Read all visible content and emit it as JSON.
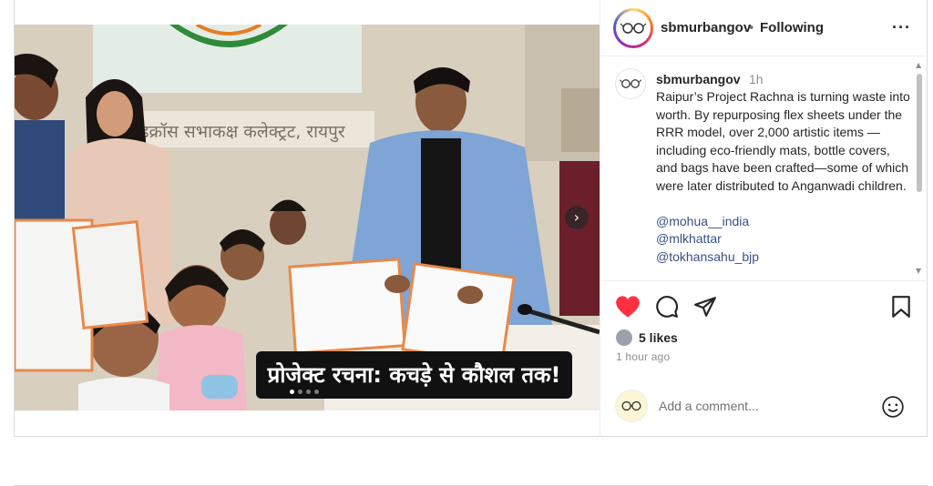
{
  "post": {
    "media": {
      "alt_banner_text": "प्रोजेक्ट रचना: कचड़े से कौशल तक!",
      "sign_text": "डक्रॉस सभाकक्ष कलेक्ट्रट, रायपुर",
      "carousel_dots": 4,
      "active_dot": 1,
      "next_icon": "chevron-right-icon"
    },
    "header": {
      "username": "sbmurbangov",
      "separator": "•",
      "follow_status": "Following",
      "more_icon": "more-horizontal-icon"
    },
    "caption": {
      "username": "sbmurbangov",
      "time": "1h",
      "text": "Raipur’s Project Rachna is turning waste into worth. By repurposing flex sheets under the RRR model, over 2,000 artistic items — including eco-friendly mats, bottle covers, and bags have been crafted—some of which were later distributed to Anganwadi children.",
      "mentions": [
        "@mohua__india",
        "@mlkhattar",
        "@tokhansahu_bjp"
      ]
    },
    "actions": {
      "like_icon": "heart-filled-icon",
      "comment_icon": "comment-icon",
      "share_icon": "send-icon",
      "save_icon": "bookmark-icon",
      "like_color": "#ff3040"
    },
    "likes": "5 likes",
    "posted_ago": "1 hour ago",
    "add_comment": {
      "placeholder": "Add a comment...",
      "emoji_icon": "smiley-icon"
    }
  }
}
